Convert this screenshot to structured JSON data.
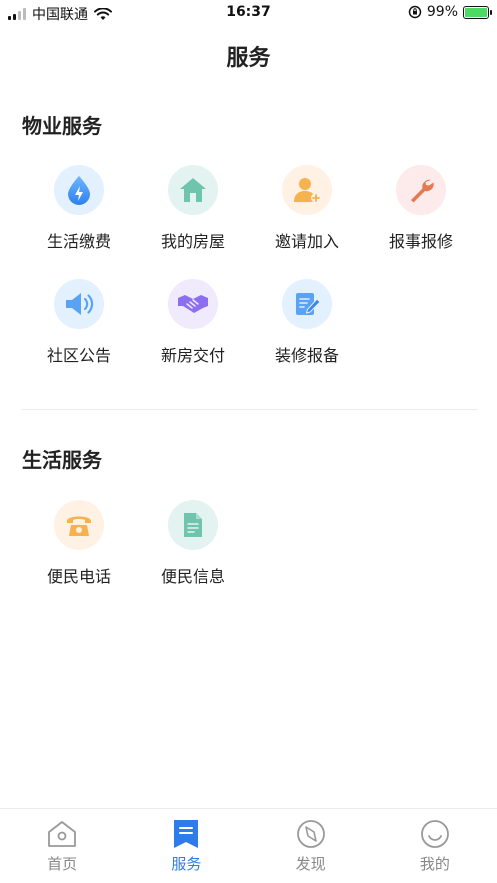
{
  "status_bar": {
    "carrier": "中国联通",
    "time": "16:37",
    "battery": "99%"
  },
  "header": {
    "title": "服务"
  },
  "property_services": {
    "title": "物业服务",
    "items": [
      {
        "label": "生活缴费",
        "icon": "water-bolt-icon",
        "bg": "#e3f0fd"
      },
      {
        "label": "我的房屋",
        "icon": "house-icon",
        "bg": "#e3f3ef"
      },
      {
        "label": "邀请加入",
        "icon": "add-user-icon",
        "bg": "#fff1e3"
      },
      {
        "label": "报事报修",
        "icon": "wrench-icon",
        "bg": "#fdeaea"
      },
      {
        "label": "社区公告",
        "icon": "speaker-icon",
        "bg": "#e3f0fd"
      },
      {
        "label": "新房交付",
        "icon": "handshake-icon",
        "bg": "#efeafc"
      },
      {
        "label": "装修报备",
        "icon": "edit-doc-icon",
        "bg": "#e3f0fd"
      }
    ]
  },
  "life_services": {
    "title": "生活服务",
    "items": [
      {
        "label": "便民电话",
        "icon": "phone-icon",
        "bg": "#fff1e3"
      },
      {
        "label": "便民信息",
        "icon": "document-icon",
        "bg": "#e3f3ef"
      }
    ]
  },
  "tab_bar": {
    "tabs": [
      {
        "label": "首页",
        "icon": "home-icon",
        "active": false
      },
      {
        "label": "服务",
        "icon": "service-icon",
        "active": true
      },
      {
        "label": "发现",
        "icon": "compass-icon",
        "active": false
      },
      {
        "label": "我的",
        "icon": "profile-icon",
        "active": false
      }
    ]
  },
  "colors": {
    "accent": "#2f7bea",
    "inactive": "#888888"
  }
}
